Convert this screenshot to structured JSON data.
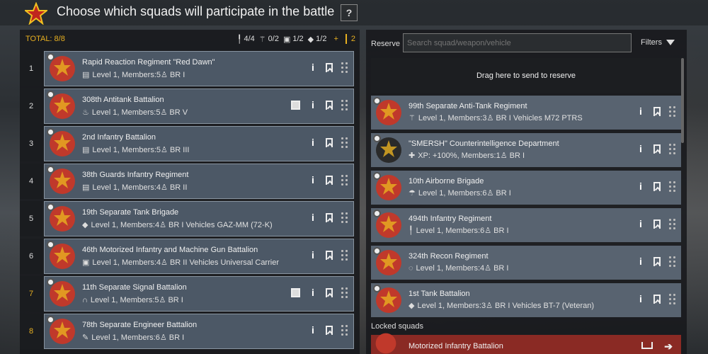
{
  "header": {
    "title": "Choose which squads will participate in the battle",
    "help_label": "?"
  },
  "left": {
    "total_label": "TOTAL: 8/8",
    "counters": [
      {
        "icon": "rifle-icon",
        "glyph": "╿",
        "value": "4/4"
      },
      {
        "icon": "parachute-icon",
        "glyph": "⚚",
        "value": "0/2"
      },
      {
        "icon": "truck-icon",
        "glyph": "▣",
        "value": "1/2"
      },
      {
        "icon": "tank-icon",
        "glyph": "◆",
        "value": "1/2"
      }
    ],
    "plus": "+",
    "extra_count": "2",
    "squads": [
      {
        "num": "1",
        "num_gold": false,
        "name": "Rapid Reaction Regiment \"Red Dawn\"",
        "meta": "Level 1, Members:5",
        "br": "BR I",
        "icon": "book-icon",
        "glyph": "▤",
        "color": "#c0392b",
        "book": false
      },
      {
        "num": "2",
        "num_gold": false,
        "name": "308th Antitank Battalion",
        "meta": "Level 1, Members:5",
        "br": "BR V",
        "icon": "fire-icon",
        "glyph": "♨",
        "color": "#c0392b",
        "book": true
      },
      {
        "num": "3",
        "num_gold": false,
        "name": "2nd Infantry Battalion",
        "meta": "Level 1, Members:5",
        "br": "BR III",
        "icon": "book-icon",
        "glyph": "▤",
        "color": "#c0392b",
        "book": false
      },
      {
        "num": "4",
        "num_gold": false,
        "name": "38th Guards Infantry Regiment",
        "meta": "Level 1, Members:4",
        "br": "BR II",
        "icon": "book-icon",
        "glyph": "▤",
        "color": "#c0392b",
        "book": false
      },
      {
        "num": "5",
        "num_gold": false,
        "name": "19th Separate Tank Brigade",
        "meta": "Level 1, Members:4",
        "br": "BR I  Vehicles GAZ-MM (72-K)",
        "icon": "tank-icon",
        "glyph": "◆",
        "color": "#c0392b",
        "book": false
      },
      {
        "num": "6",
        "num_gold": false,
        "name": "46th Motorized Infantry and Machine Gun Battalion",
        "meta": "Level 1, Members:4",
        "br": "BR II  Vehicles Universal Carrier",
        "icon": "truck-icon",
        "glyph": "▣",
        "color": "#c0392b",
        "book": false
      },
      {
        "num": "7",
        "num_gold": true,
        "name": "11th Separate Signal Battalion",
        "meta": "Level 1, Members:5",
        "br": "BR I",
        "icon": "headphones-icon",
        "glyph": "∩",
        "color": "#c0392b",
        "book": true
      },
      {
        "num": "8",
        "num_gold": true,
        "name": "78th Separate Engineer Battalion",
        "meta": "Level 1, Members:6",
        "br": "BR I",
        "icon": "wrench-icon",
        "glyph": "✎",
        "color": "#c0392b",
        "book": false
      }
    ]
  },
  "right": {
    "reserve_label": "Reserve",
    "search_placeholder": "Search squad/weapon/vehicle",
    "filters_label": "Filters",
    "dropzone_text": "Drag here to send to reserve",
    "squads": [
      {
        "name": "99th Separate Anti-Tank Regiment",
        "meta": "Level 1, Members:3",
        "br": "BR I  Vehicles M72 PTRS",
        "icon": "parachute-icon",
        "glyph": "⚚",
        "color": "#c0392b"
      },
      {
        "name": "\"SMERSH\" Counterintelligence Department",
        "meta": "XP: +100%, Members:1",
        "br": "BR I",
        "icon": "badge-icon",
        "glyph": "✚",
        "color": "#2a2a2a"
      },
      {
        "name": "10th Airborne Brigade",
        "meta": "Level 1, Members:6",
        "br": "BR I",
        "icon": "parachute-icon",
        "glyph": "☂",
        "color": "#c0392b"
      },
      {
        "name": "494th Infantry Regiment",
        "meta": "Level 1, Members:6",
        "br": "BR I",
        "icon": "rifle-icon",
        "glyph": "╿",
        "color": "#c0392b"
      },
      {
        "name": "324th Recon Regiment",
        "meta": "Level 1, Members:4",
        "br": "BR I",
        "icon": "scope-icon",
        "glyph": "◌",
        "color": "#c0392b"
      },
      {
        "name": "1st Tank Battalion",
        "meta": "Level 1, Members:3",
        "br": "BR I  Vehicles BT-7 (Veteran)",
        "icon": "tank-icon",
        "glyph": "◆",
        "color": "#c0392b"
      }
    ],
    "locked_label": "Locked squads",
    "locked_squad": "Motorized Infantry Battalion"
  },
  "colors": {
    "accent": "#e8b020",
    "card": "#4c5866",
    "locked": "#8a2a24"
  }
}
